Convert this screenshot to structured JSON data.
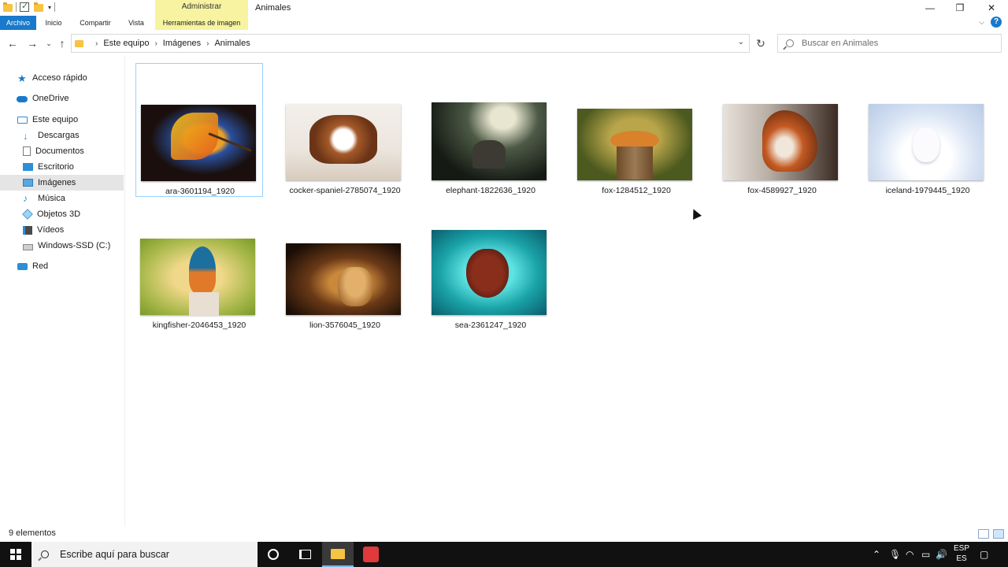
{
  "window": {
    "title": "Animales",
    "contextual_group": "Administrar",
    "minimize_label": "—",
    "maximize_label": "❐",
    "close_label": "✕"
  },
  "ribbon": {
    "tabs": [
      {
        "label": "Archivo"
      },
      {
        "label": "Inicio"
      },
      {
        "label": "Compartir"
      },
      {
        "label": "Vista"
      },
      {
        "label": "Herramientas de imagen"
      }
    ]
  },
  "address": {
    "crumbs": [
      "Este equipo",
      "Imágenes",
      "Animales"
    ]
  },
  "search": {
    "placeholder": "Buscar en Animales"
  },
  "sidebar": {
    "items": [
      {
        "label": "Acceso rápido",
        "icon": "star-icon"
      },
      {
        "label": "OneDrive",
        "icon": "cloud-icon"
      },
      {
        "label": "Este equipo",
        "icon": "computer-icon"
      },
      {
        "label": "Descargas",
        "icon": "download-icon"
      },
      {
        "label": "Documentos",
        "icon": "document-icon"
      },
      {
        "label": "Escritorio",
        "icon": "desktop-icon"
      },
      {
        "label": "Imágenes",
        "icon": "pictures-icon",
        "selected": true
      },
      {
        "label": "Música",
        "icon": "music-icon"
      },
      {
        "label": "Objetos 3D",
        "icon": "3d-objects-icon"
      },
      {
        "label": "Vídeos",
        "icon": "video-icon"
      },
      {
        "label": "Windows-SSD (C:)",
        "icon": "drive-icon"
      },
      {
        "label": "Red",
        "icon": "network-icon"
      }
    ]
  },
  "files": [
    {
      "name": "ara-3601194_1920",
      "subject": "parrot"
    },
    {
      "name": "cocker-spaniel-2785074_1920",
      "subject": "dog"
    },
    {
      "name": "elephant-1822636_1920",
      "subject": "elephant"
    },
    {
      "name": "fox-1284512_1920",
      "subject": "fox"
    },
    {
      "name": "fox-4589927_1920",
      "subject": "fox"
    },
    {
      "name": "iceland-1979445_1920",
      "subject": "arctic fox"
    },
    {
      "name": "kingfisher-2046453_1920",
      "subject": "kingfisher"
    },
    {
      "name": "lion-3576045_1920",
      "subject": "lion"
    },
    {
      "name": "sea-2361247_1920",
      "subject": "sea turtle"
    }
  ],
  "status": {
    "item_count": "9 elementos"
  },
  "taskbar": {
    "search_placeholder": "Escribe aquí para buscar",
    "lang_top": "ESP",
    "lang_bottom": "ES"
  },
  "colors": {
    "accent": "#1979ca",
    "contextual_tab": "#f7f3a0",
    "taskbar": "#111111",
    "selected_nav": "#e5e5e5"
  }
}
